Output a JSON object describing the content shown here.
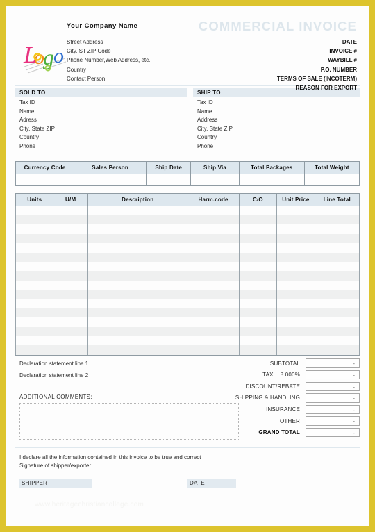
{
  "document": {
    "title": "COMMERCIAL INVOICE",
    "company_name": "Your Company Name",
    "company_lines": [
      "Street Address",
      "City, ST  ZIP Code",
      "Phone Number,Web Address, etc.",
      "Country",
      "Contact Person"
    ],
    "meta_labels": [
      "DATE",
      "INVOICE #",
      "WAYBILL #",
      "P.O. NUMBER",
      "TERMS OF SALE (INCOTERM)",
      "REASON FOR EXPORT"
    ],
    "logo_text": "Logo",
    "watermark": "www.heritagechristiancollege.com"
  },
  "parties": [
    {
      "heading": "SOLD  TO",
      "lines": [
        "Tax ID",
        "Name",
        "Adress",
        "City, State ZIP",
        "Country",
        "Phone"
      ]
    },
    {
      "heading": "SHIP TO",
      "lines": [
        "Tax ID",
        "Name",
        "Address",
        "City, State ZIP",
        "Country",
        "Phone"
      ]
    }
  ],
  "shipping_table": {
    "headers": [
      "Currency Code",
      "Sales Person",
      "Ship Date",
      "Ship Via",
      "Total Packages",
      "Total Weight"
    ],
    "values": [
      "",
      "",
      "",
      "",
      "",
      ""
    ]
  },
  "items_table": {
    "headers": [
      "Units",
      "U/M",
      "Description",
      "Harm.code",
      "C/O",
      "Unit Price",
      "Line Total"
    ],
    "row_count": 16,
    "rows": []
  },
  "declarations": {
    "line1": "Declaration statement line 1",
    "line2": "Declaration statement line 2",
    "comments_label": "ADDITIONAL COMMENTS:",
    "comments_value": ""
  },
  "totals": [
    {
      "label": "SUBTOTAL",
      "pct": "",
      "value": "-"
    },
    {
      "label": "TAX",
      "pct": "8.000%",
      "value": "-"
    },
    {
      "label": "DISCOUNT/REBATE",
      "pct": "",
      "value": "-"
    },
    {
      "label": "SHIPPING & HANDLING",
      "pct": "",
      "value": "-"
    },
    {
      "label": "INSURANCE",
      "pct": "",
      "value": "-"
    },
    {
      "label": "OTHER",
      "pct": "",
      "value": "-"
    },
    {
      "label": "GRAND TOTAL",
      "pct": "",
      "value": "-"
    }
  ],
  "footer": {
    "declare_line1": "I declare all the information contained in this invoice to be true and correct",
    "declare_line2": "Signature of shipper/exporter",
    "shipper_label": "SHIPPER",
    "shipper_value": "",
    "date_label": "DATE",
    "date_value": ""
  },
  "colors": {
    "border_gold": "#ddc42e",
    "header_blue": "#dde7ee",
    "party_blue": "#e2eaf0",
    "title_tint": "#dde6ec",
    "stripe": "#eff0f0"
  }
}
